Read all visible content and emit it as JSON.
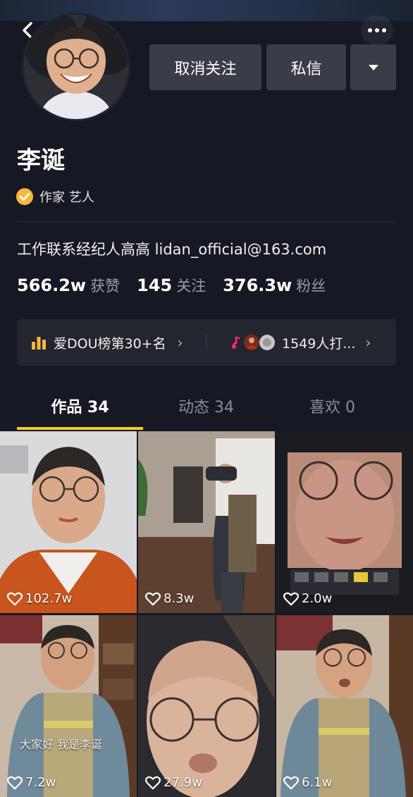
{
  "profile": {
    "name": "李诞",
    "verification": "作家 艺人",
    "bio": "工作联系经纪人高高 lidan_official@163.com"
  },
  "actions": {
    "unfollow_label": "取消关注",
    "message_label": "私信"
  },
  "stats": [
    {
      "value": "566.2w",
      "label": "获赞"
    },
    {
      "value": "145",
      "label": "关注"
    },
    {
      "value": "376.3w",
      "label": "粉丝"
    }
  ],
  "promo": {
    "rank_text": "爱DOU榜第30+名",
    "fans_text": "1549人打..."
  },
  "tabs": [
    {
      "label": "作品 34",
      "active": true
    },
    {
      "label": "动态 34",
      "active": false
    },
    {
      "label": "喜欢 0",
      "active": false
    }
  ],
  "videos": [
    {
      "likes": "102.7w"
    },
    {
      "likes": "8.3w"
    },
    {
      "likes": "2.0w"
    },
    {
      "likes": "7.2w",
      "caption": "大家好 我是李诞"
    },
    {
      "likes": "27.9w"
    },
    {
      "likes": "6.1w"
    }
  ],
  "colors": {
    "background": "#161823",
    "accent": "#face15",
    "button": "#3a3c48"
  }
}
